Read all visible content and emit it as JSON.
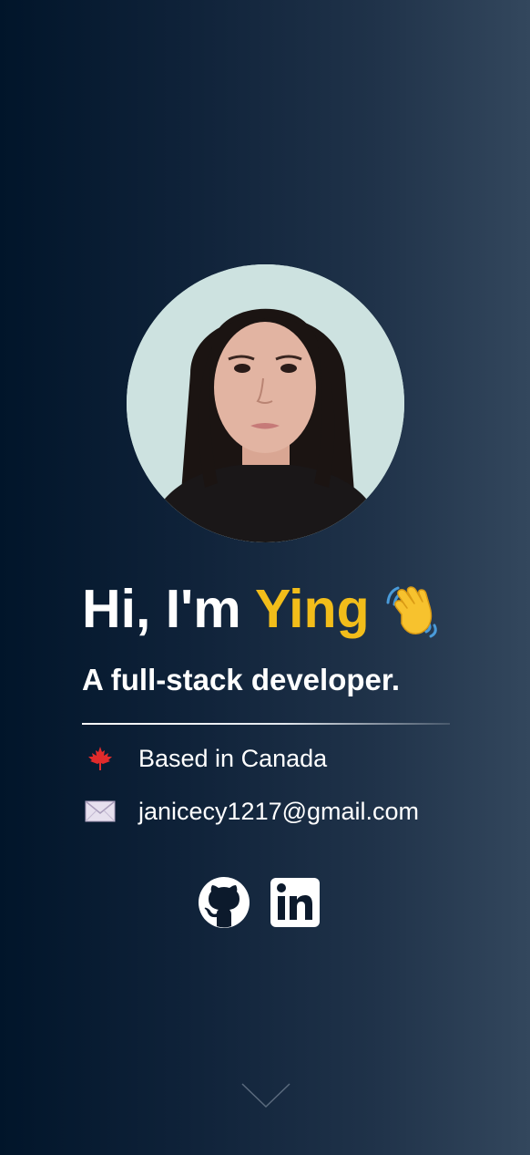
{
  "hero": {
    "greeting": "Hi, I'm ",
    "name": "Ying",
    "tagline": "A full-stack developer.",
    "avatar_icon": "profile-photo",
    "wave_icon": "waving-hand-icon"
  },
  "info": {
    "location": "Based in Canada",
    "location_icon": "maple-leaf-icon",
    "email": "janicecy1217@gmail.com",
    "email_icon": "envelope-icon"
  },
  "socials": [
    {
      "icon": "github-icon"
    },
    {
      "icon": "linkedin-icon"
    }
  ],
  "scroll_icon": "chevron-down-icon",
  "colors": {
    "accent": "#f2bd1a",
    "text": "#ffffff",
    "background_start": "#01152a",
    "background_end": "#33475d"
  }
}
